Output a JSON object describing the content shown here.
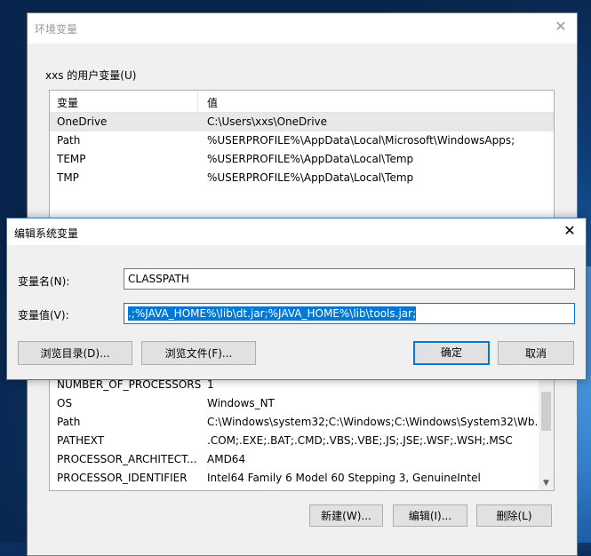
{
  "main_window": {
    "title": "环境变量",
    "close_glyph": "✕",
    "user_group_label": "xxs 的用户变量(U)",
    "columns": {
      "var": "变量",
      "val": "值"
    },
    "user_vars": [
      {
        "name": "OneDrive",
        "value": "C:\\Users\\xxs\\OneDrive"
      },
      {
        "name": "Path",
        "value": "%USERPROFILE%\\AppData\\Local\\Microsoft\\WindowsApps;"
      },
      {
        "name": "TEMP",
        "value": "%USERPROFILE%\\AppData\\Local\\Temp"
      },
      {
        "name": "TMP",
        "value": "%USERPROFILE%\\AppData\\Local\\Temp"
      }
    ],
    "system_vars": [
      {
        "name": "NUMBER_OF_PROCESSORS",
        "value": "1"
      },
      {
        "name": "OS",
        "value": "Windows_NT"
      },
      {
        "name": "Path",
        "value": "C:\\Windows\\system32;C:\\Windows;C:\\Windows\\System32\\Wb..."
      },
      {
        "name": "PATHEXT",
        "value": ".COM;.EXE;.BAT;.CMD;.VBS;.VBE;.JS;.JSE;.WSF;.WSH;.MSC"
      },
      {
        "name": "PROCESSOR_ARCHITECT...",
        "value": "AMD64"
      },
      {
        "name": "PROCESSOR_IDENTIFIER",
        "value": "Intel64 Family 6 Model 60 Stepping 3, GenuineIntel"
      }
    ],
    "buttons": {
      "new": "新建(W)...",
      "edit": "编辑(I)...",
      "delete": "删除(L)"
    }
  },
  "dialog": {
    "title": "编辑系统变量",
    "close_glyph": "✕",
    "name_label": "变量名(N):",
    "name_value": "CLASSPATH",
    "value_label": "变量值(V):",
    "value_value": ".;%JAVA_HOME%\\lib\\dt.jar;%JAVA_HOME%\\lib\\tools.jar;",
    "buttons": {
      "browse_dir": "浏览目录(D)...",
      "browse_file": "浏览文件(F)...",
      "ok": "确定",
      "cancel": "取消"
    }
  },
  "colors": {
    "accent": "#0078d7",
    "dialog_border": "#2b79c2"
  }
}
